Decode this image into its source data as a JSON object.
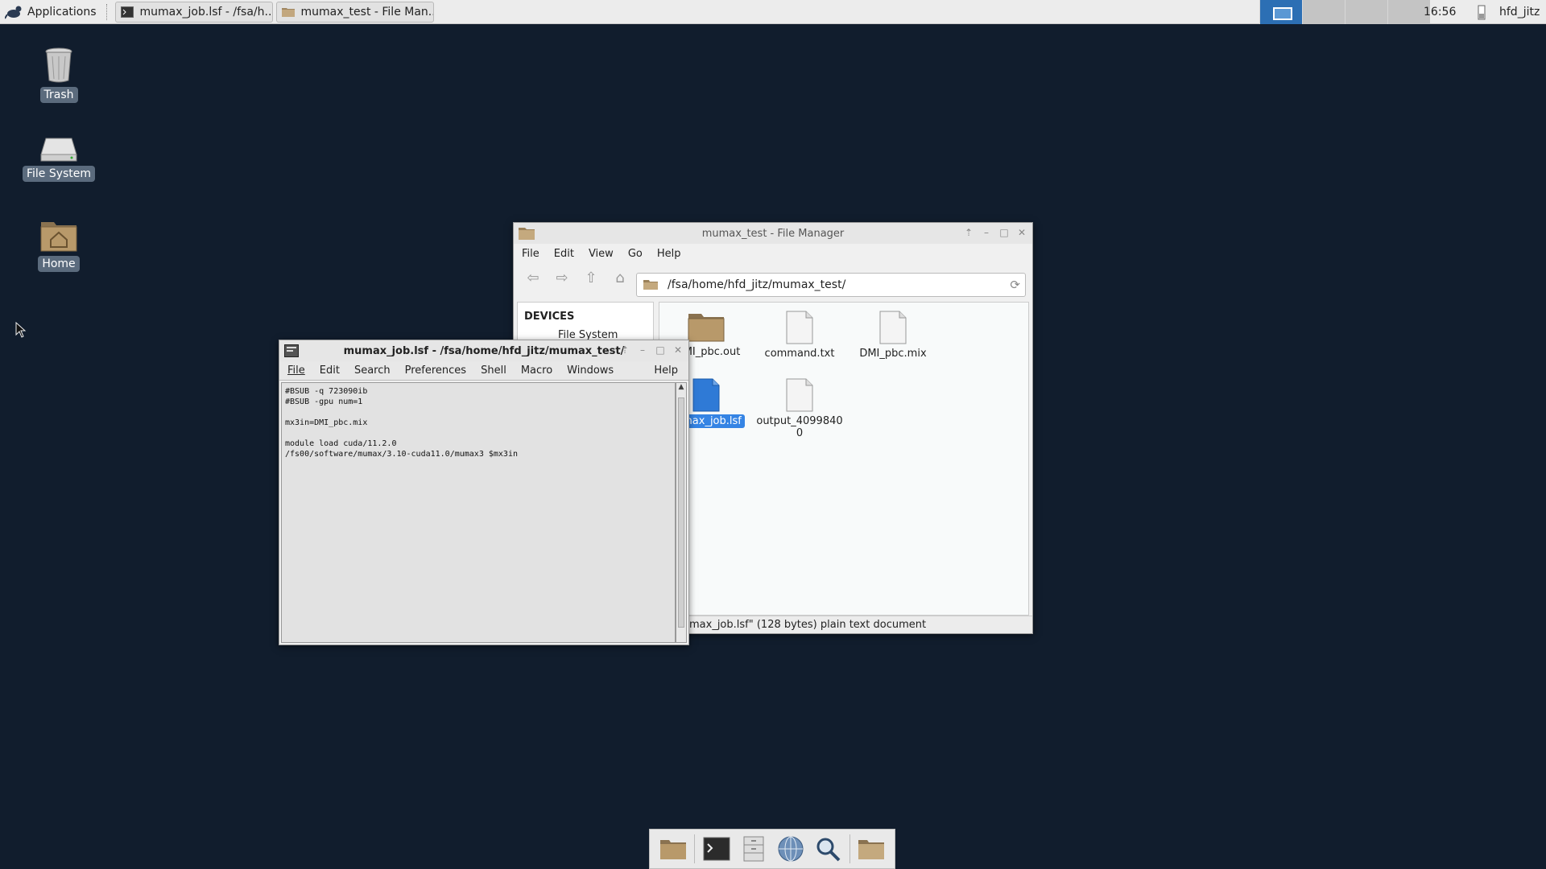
{
  "panel": {
    "applications_label": "Applications",
    "tasks": [
      {
        "label": "mumax_job.lsf - /fsa/h..."
      },
      {
        "label": "mumax_test - File Man..."
      }
    ],
    "clock": "16:56",
    "user": "hfd_jitz"
  },
  "desktop": {
    "icons": [
      {
        "label": "Trash"
      },
      {
        "label": "File System"
      },
      {
        "label": "Home"
      }
    ]
  },
  "file_manager": {
    "title": "mumax_test - File Manager",
    "menu": [
      "File",
      "Edit",
      "View",
      "Go",
      "Help"
    ],
    "location": "/fsa/home/hfd_jitz/mumax_test/",
    "sidebar_header": "DEVICES",
    "sidebar_items": [
      "File System"
    ],
    "files": [
      {
        "name": "DMI_pbc.out",
        "visible_name": "MI_pbc.out",
        "type": "folder"
      },
      {
        "name": "command.txt",
        "type": "text"
      },
      {
        "name": "DMI_pbc.mix",
        "type": "text"
      },
      {
        "name": "mumax_job.lsf",
        "visible_name": "max_job.lsf",
        "type": "text-selected"
      },
      {
        "name": "output_40998400",
        "line1": "output_4099840",
        "line2": "0",
        "type": "text"
      }
    ],
    "status": "max_job.lsf\" (128 bytes) plain text document"
  },
  "editor": {
    "title": "mumax_job.lsf - /fsa/home/hfd_jitz/mumax_test/",
    "menu": [
      "File",
      "Edit",
      "Search",
      "Preferences",
      "Shell",
      "Macro",
      "Windows"
    ],
    "help": "Help",
    "content": "#BSUB -q 723090ib\n#BSUB -gpu num=1\n\nmx3in=DMI_pbc.mix\n\nmodule load cuda/11.2.0\n/fs00/software/mumax/3.10-cuda11.0/mumax3 $mx3in\n"
  },
  "dock": {
    "items": [
      "file-manager-icon",
      "terminal-icon",
      "file-cabinet-icon",
      "web-browser-icon",
      "search-icon",
      "folder-icon"
    ]
  }
}
